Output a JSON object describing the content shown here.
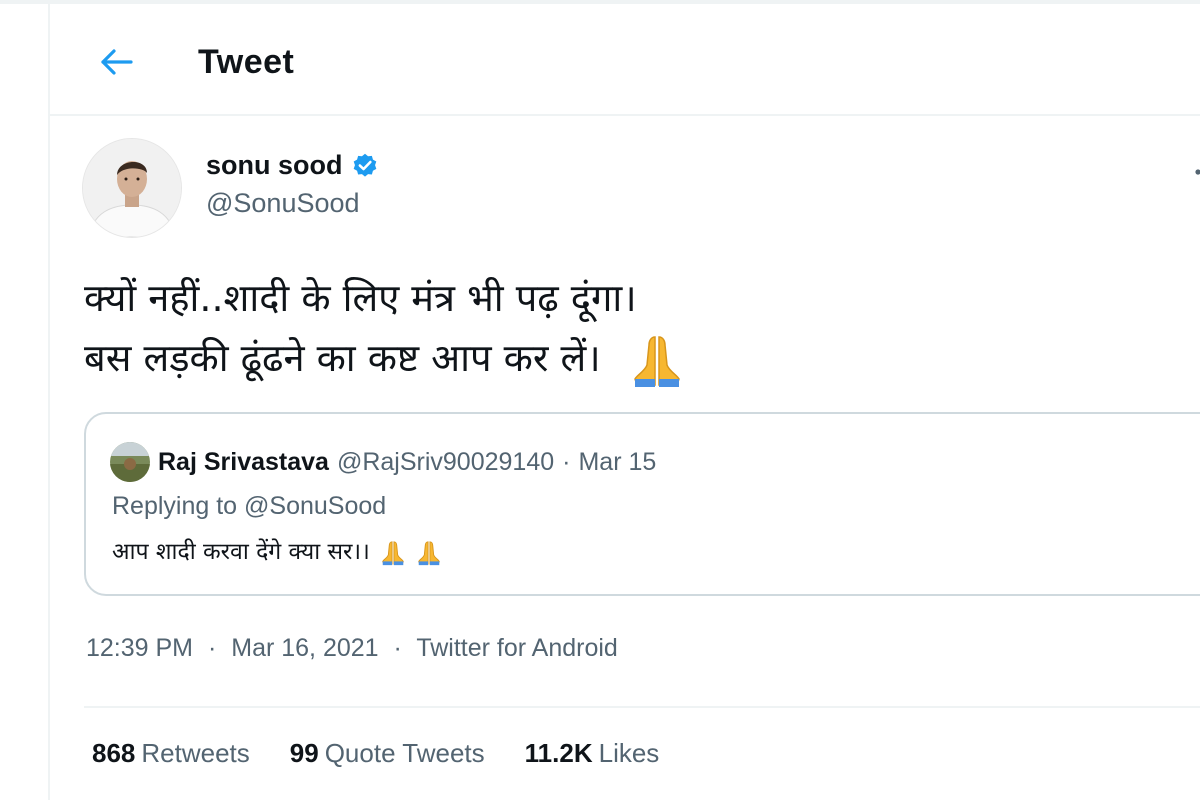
{
  "header": {
    "title": "Tweet",
    "back_icon": "arrow-left-icon",
    "accent_color": "#1d9bf0"
  },
  "tweet": {
    "author": {
      "name": "sonu sood",
      "handle": "@SonuSood",
      "verified": true,
      "verified_icon": "verified-badge-icon"
    },
    "text_lines": [
      "क्यों नहीं..शादी के लिए मंत्र भी पढ़ दूंगा।",
      "बस लड़की ढूंढने का कष्ट आप कर लें।"
    ],
    "text_emoji": "folded-hands-icon",
    "quoted": {
      "name": "Raj Srivastava",
      "handle": "@RajSriv90029140",
      "separator": "·",
      "date": "Mar 15",
      "replying_to": "Replying to @SonuSood",
      "text": "आप शादी करवा देंगे क्या सर।।",
      "emoji_count": 2
    },
    "meta": {
      "time": "12:39 PM",
      "separator": "·",
      "date": "Mar 16, 2021",
      "source": "Twitter for Android"
    },
    "stats": {
      "retweets": {
        "count": "868",
        "label": "Retweets"
      },
      "quote_tweets": {
        "count": "99",
        "label": "Quote Tweets"
      },
      "likes": {
        "count": "11.2K",
        "label": "Likes"
      }
    }
  },
  "colors": {
    "text_primary": "#0f1419",
    "text_secondary": "#536471",
    "border": "#cfd9de",
    "verified": "#1d9bf0",
    "emoji": "#f7b731"
  }
}
